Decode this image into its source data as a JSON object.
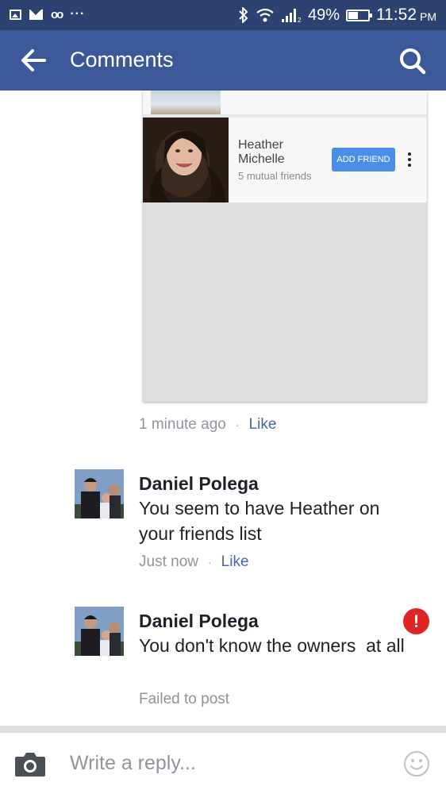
{
  "status_bar": {
    "battery": "49%",
    "time": "11:52",
    "ampm": "PM",
    "overflow": "···"
  },
  "app_bar": {
    "title": "Comments"
  },
  "shared_card": {
    "friend_name": "Heather Michelle",
    "mutual_friends": "5 mutual friends",
    "add_friend_label": "ADD FRIEND"
  },
  "post_meta": {
    "time": "1 minute ago",
    "separator": "·",
    "like_label": "Like"
  },
  "comments": [
    {
      "author": "Daniel Polega",
      "text": "You seem to have Heather on your friends list",
      "status": "Just now",
      "separator": "·",
      "like_label": "Like"
    },
    {
      "author": "Daniel Polega",
      "text": "You don't know the owners  at all",
      "status": "Failed to post",
      "error_glyph": "!"
    }
  ],
  "reply": {
    "placeholder": "Write a reply..."
  },
  "colors": {
    "status_bar": "#2c4271",
    "app_bar": "#3b5998",
    "link": "#4b67a1",
    "add_friend": "#4a8eea",
    "error": "#e02525"
  },
  "icons": [
    "image-icon",
    "mail-icon",
    "voicemail-icon",
    "bluetooth-icon",
    "wifi-icon",
    "signal-icon",
    "battery-icon",
    "back-arrow-icon",
    "search-icon",
    "more-vertical-icon",
    "error-icon",
    "camera-icon",
    "smiley-icon"
  ]
}
